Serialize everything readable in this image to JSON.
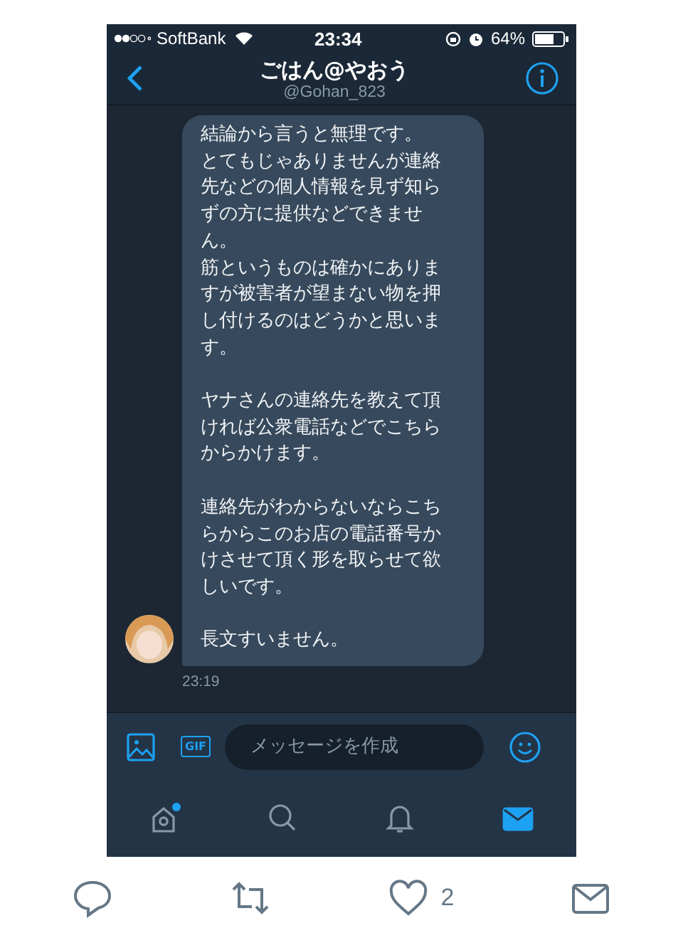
{
  "status_bar": {
    "carrier": "SoftBank",
    "time": "23:34",
    "battery": "64%"
  },
  "header": {
    "title": "ごはん@やおう",
    "handle": "@Gohan_823"
  },
  "message": {
    "paragraphs": [
      {
        "lines": [
          "結論から言うと無理です。",
          "とてもじゃありませんが連絡",
          "先などの個人情報を見ず知ら",
          "ずの方に提供などできませ",
          "ん。",
          "筋というものは確かにありま",
          "すが被害者が望まない物を押",
          "し付けるのはどうかと思いま",
          "す。"
        ]
      },
      {
        "lines": [
          "ヤナさんの連絡先を教えて頂",
          "ければ公衆電話などでこちら",
          "からかけます。"
        ]
      },
      {
        "lines": [
          "連絡先がわからないならこち",
          "らからこのお店の電話番号か",
          "けさせて頂く形を取らせて欲",
          "しいです。"
        ]
      },
      {
        "lines": [
          "長文すいません。"
        ]
      }
    ],
    "time": "23:19"
  },
  "composer": {
    "gif": "GIF",
    "placeholder": "メッセージを作成"
  },
  "tabs": [
    {
      "kind": "home",
      "selected": false,
      "dot": true
    },
    {
      "kind": "search",
      "selected": false,
      "dot": false
    },
    {
      "kind": "notifications",
      "selected": false,
      "dot": false
    },
    {
      "kind": "messages",
      "selected": true,
      "dot": false
    }
  ],
  "tweet_actions": [
    {
      "kind": "reply"
    },
    {
      "kind": "retweet"
    },
    {
      "kind": "like",
      "count": "2"
    },
    {
      "kind": "dm"
    }
  ]
}
